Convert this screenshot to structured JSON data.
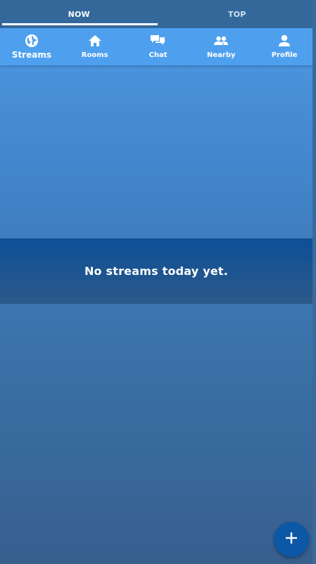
{
  "top_tabs": [
    {
      "label": "NOW",
      "active": true
    },
    {
      "label": "TOP",
      "active": false
    }
  ],
  "nav": {
    "items": [
      {
        "label": "Streams",
        "icon": "globe-icon",
        "active": true
      },
      {
        "label": "Rooms",
        "icon": "home-icon",
        "active": false
      },
      {
        "label": "Chat",
        "icon": "chat-icon",
        "active": false
      },
      {
        "label": "Nearby",
        "icon": "people-icon",
        "active": false
      },
      {
        "label": "Profile",
        "icon": "person-icon",
        "active": false
      }
    ]
  },
  "main": {
    "empty_message": "No streams today yet."
  },
  "fab": {
    "icon": "plus-icon"
  },
  "colors": {
    "nav_bar": "#4ea0ee",
    "top_tabs": "#34689a",
    "banner": "#0d4f96",
    "fab": "#0c57a6"
  }
}
